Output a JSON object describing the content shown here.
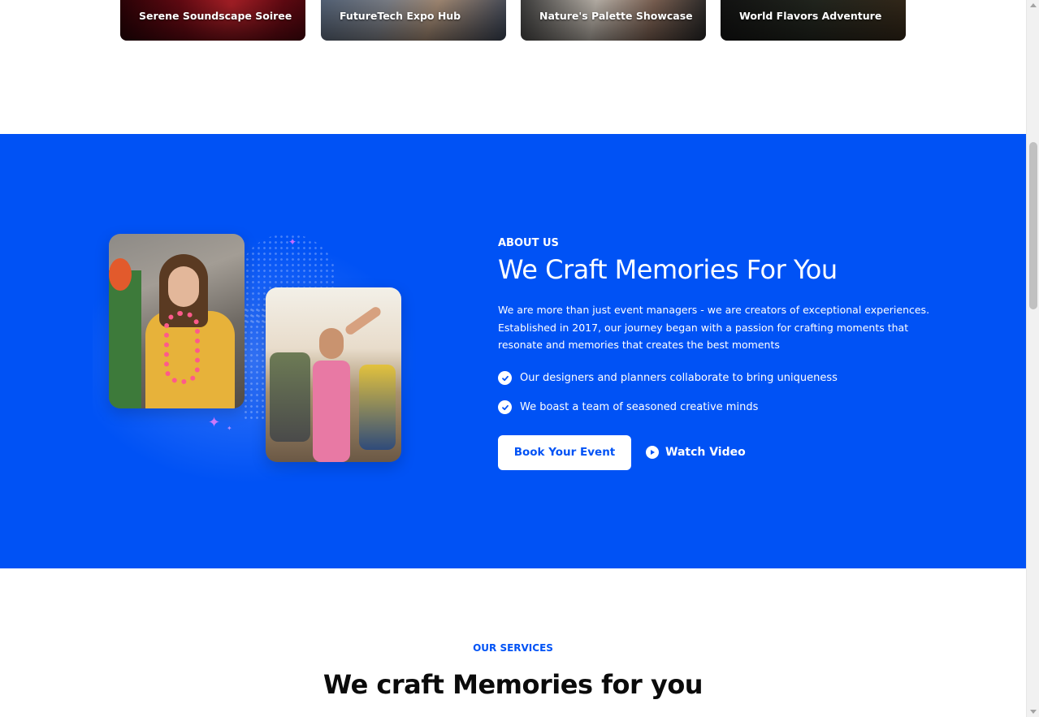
{
  "events": {
    "cards": [
      {
        "title": "Serene Soundscape Soiree"
      },
      {
        "title": "FutureTech Expo Hub"
      },
      {
        "title": "Nature's Palette Showcase"
      },
      {
        "title": "World Flavors Adventure"
      }
    ]
  },
  "about": {
    "eyebrow": "ABOUT US",
    "heading": "We Craft Memories For You",
    "description": "We are more than just event managers - we are creators of exceptional experiences. Established in 2017, our journey began with a passion for crafting moments that resonate and memories that creates the best moments",
    "checklist": [
      {
        "text": "Our designers and planners collaborate to bring uniqueness",
        "icon": "check-circle-icon"
      },
      {
        "text": "We boast a team of seasoned creative minds",
        "icon": "check-circle-icon"
      }
    ],
    "book_button": "Book Your Event",
    "watch_label": "Watch Video",
    "watch_icon": "play-circle-icon",
    "background_color": "#0052f5"
  },
  "services": {
    "eyebrow": "OUR SERVICES",
    "heading": "We craft Memories for you"
  },
  "colors": {
    "brand_blue": "#0052f5",
    "white": "#ffffff",
    "heading_dark": "#0b0b0b"
  }
}
